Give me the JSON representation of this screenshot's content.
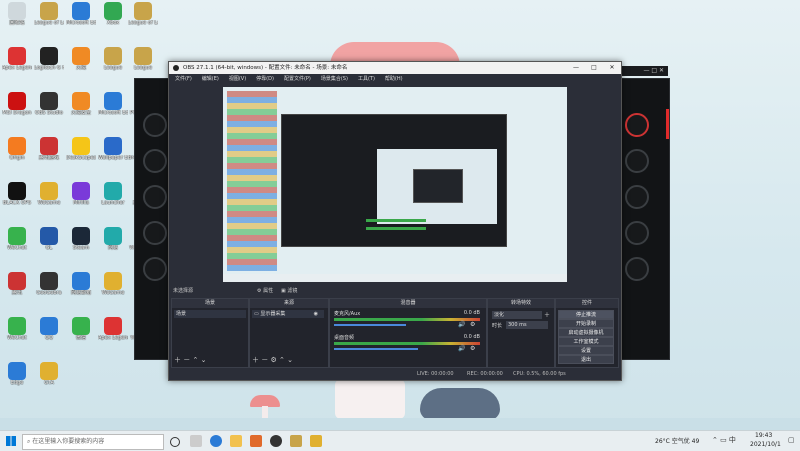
{
  "desktop": {
    "icons": [
      {
        "label": "回收站",
        "color": "#cfd8dc"
      },
      {
        "label": "League of Legends",
        "color": "#c8a44a"
      },
      {
        "label": "Microsoft Edge",
        "color": "#2b7bd6"
      },
      {
        "label": "Xbox",
        "color": "#32a852"
      },
      {
        "label": "League of Legends",
        "color": "#c8a44a"
      },
      {
        "label": "Apex Legends",
        "color": "#d33"
      },
      {
        "label": "Logitech G HUB",
        "color": "#222"
      },
      {
        "label": "火绒",
        "color": "#f08a24"
      },
      {
        "label": "League",
        "color": "#c8a44a"
      },
      {
        "label": "League",
        "color": "#c8a44a"
      },
      {
        "label": "MSI Dragon",
        "color": "#c11"
      },
      {
        "label": "OBS Studio",
        "color": "#333"
      },
      {
        "label": "火绒安全",
        "color": "#f08a24"
      },
      {
        "label": "Microsoft Edge",
        "color": "#2b7bd6"
      },
      {
        "label": "POGO 助手",
        "color": "#c33"
      },
      {
        "label": "Origin",
        "color": "#f47b20"
      },
      {
        "label": "腾讯游戏",
        "color": "#c33"
      },
      {
        "label": "DeskScapes",
        "color": "#f5c518"
      },
      {
        "label": "Wallpaper Engine",
        "color": "#2a6ac9"
      },
      {
        "label": "BrookinDark",
        "color": "#333"
      },
      {
        "label": "BLACK OPS",
        "color": "#111"
      },
      {
        "label": "WeGame",
        "color": "#e0b030"
      },
      {
        "label": "Mirillis",
        "color": "#7a3ad9"
      },
      {
        "label": "Launcher",
        "color": "#2aa"
      },
      {
        "label": "腾讯会议",
        "color": "#2b7bd6"
      },
      {
        "label": "WeChat",
        "color": "#37b24d"
      },
      {
        "label": "GL",
        "color": "#2459a8"
      },
      {
        "label": "Steam",
        "color": "#1b2838"
      },
      {
        "label": "网易",
        "color": "#2aa"
      },
      {
        "label": "WPS Office",
        "color": "#d33"
      },
      {
        "label": "腾讯",
        "color": "#c33"
      },
      {
        "label": "GeoGebra",
        "color": "#333"
      },
      {
        "label": "网易邮箱",
        "color": "#2b7bd6"
      },
      {
        "label": "WeGame",
        "color": "#e0b030"
      },
      {
        "label": "MSI",
        "color": "#c11"
      },
      {
        "label": "WeChat",
        "color": "#37b24d"
      },
      {
        "label": "QQ",
        "color": "#2b7bd6"
      },
      {
        "label": "微信",
        "color": "#37b24d"
      },
      {
        "label": "Apex Legends",
        "color": "#d33"
      },
      {
        "label": "Wallpaper",
        "color": "#2a6ac9"
      },
      {
        "label": "Edge",
        "color": "#2b7bd6"
      },
      {
        "label": "GTA",
        "color": "#e0b030"
      }
    ]
  },
  "obs": {
    "title": "OBS 27.1.1 (64-bit, windows) - 配置文件: 未命名 - 场景: 未命名",
    "menu": [
      "文件(F)",
      "编辑(E)",
      "视图(V)",
      "停靠(D)",
      "配置文件(P)",
      "场景集合(S)",
      "工具(T)",
      "帮助(H)"
    ],
    "source_selected": "未选择源",
    "props_label": "属性",
    "filters_label": "滤镜",
    "docks": {
      "scenes": {
        "title": "场景",
        "item": "场景"
      },
      "sources": {
        "title": "来源",
        "item": "显示器采集"
      },
      "mixer": {
        "title": "混音器",
        "channels": [
          {
            "name": "麦克风/Aux",
            "db": "0.0 dB",
            "level": 0.6
          },
          {
            "name": "桌面音频",
            "db": "0.0 dB",
            "level": 0.7
          }
        ]
      },
      "transitions": {
        "title": "转场特效",
        "type": "淡化",
        "duration_label": "时长",
        "duration": "300 ms"
      },
      "controls": {
        "title": "控件",
        "buttons": [
          "停止推流",
          "开始录制",
          "启动虚拟摄像机",
          "工作室模式",
          "设置",
          "退出"
        ]
      }
    },
    "status": {
      "live": "LIVE: 00:00:00",
      "rec": "REC: 00:00:00",
      "cpu": "CPU: 0.5%, 60.00 fps"
    }
  },
  "taskbar": {
    "search_placeholder": "在这里输入你要搜索的内容",
    "weather": "26°C 空气优 49",
    "time": "19:43",
    "date": "2021/10/1"
  }
}
